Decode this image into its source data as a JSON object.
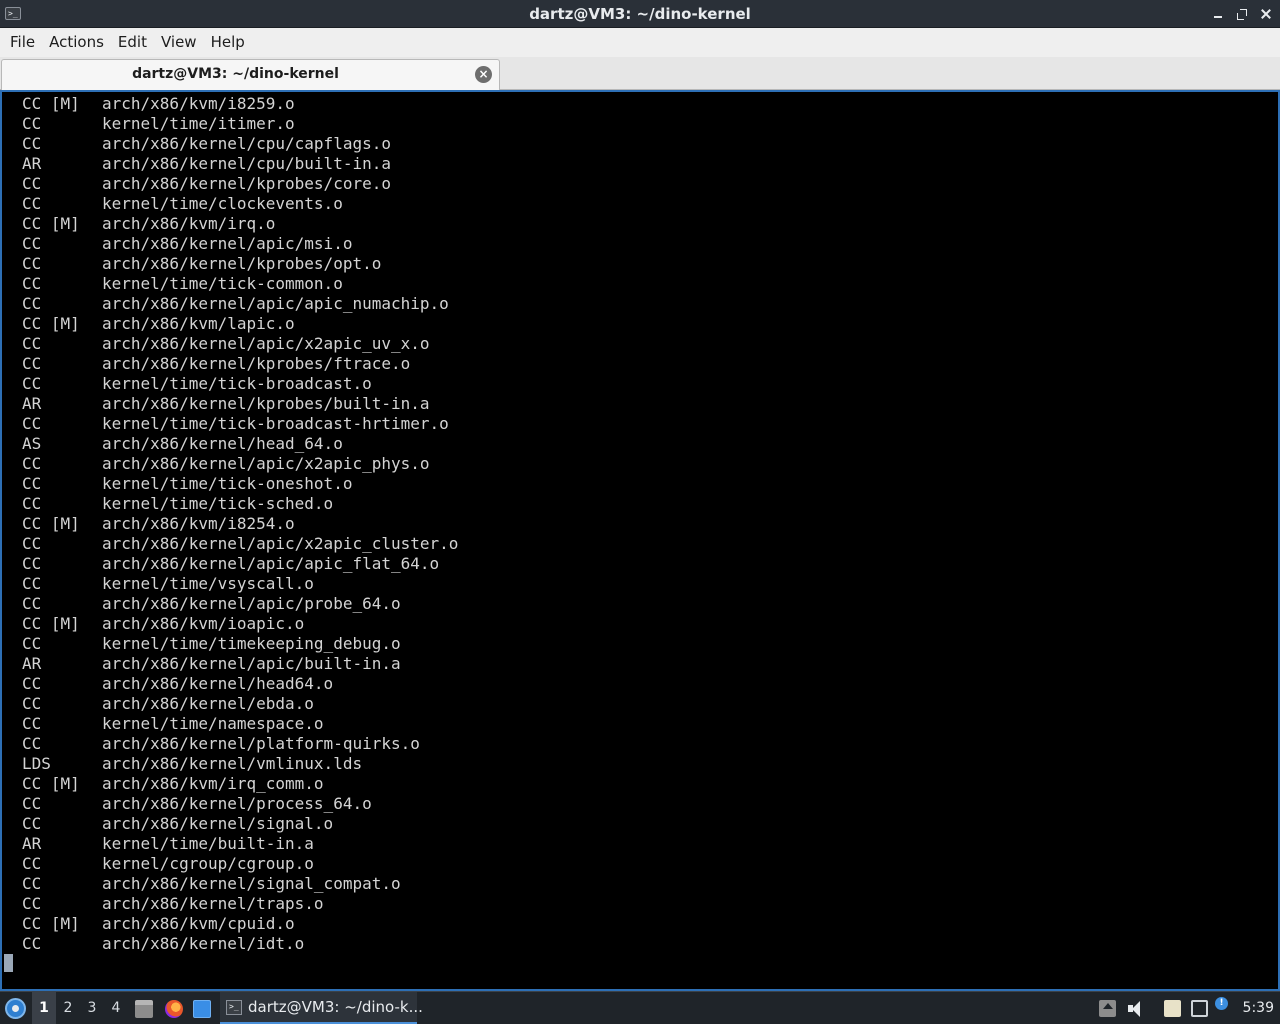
{
  "window": {
    "title": "dartz@VM3: ~/dino-kernel",
    "icon": "terminal-icon"
  },
  "menubar": {
    "items": [
      "File",
      "Actions",
      "Edit",
      "View",
      "Help"
    ]
  },
  "tabs": [
    {
      "label": "dartz@VM3: ~/dino-kernel",
      "close_icon": "close-circle-icon"
    }
  ],
  "terminal": {
    "lines": [
      {
        "tag": "CC [M]",
        "path": "arch/x86/kvm/i8259.o"
      },
      {
        "tag": "CC",
        "path": "kernel/time/itimer.o"
      },
      {
        "tag": "CC",
        "path": "arch/x86/kernel/cpu/capflags.o"
      },
      {
        "tag": "AR",
        "path": "arch/x86/kernel/cpu/built-in.a"
      },
      {
        "tag": "CC",
        "path": "arch/x86/kernel/kprobes/core.o"
      },
      {
        "tag": "CC",
        "path": "kernel/time/clockevents.o"
      },
      {
        "tag": "CC [M]",
        "path": "arch/x86/kvm/irq.o"
      },
      {
        "tag": "CC",
        "path": "arch/x86/kernel/apic/msi.o"
      },
      {
        "tag": "CC",
        "path": "arch/x86/kernel/kprobes/opt.o"
      },
      {
        "tag": "CC",
        "path": "kernel/time/tick-common.o"
      },
      {
        "tag": "CC",
        "path": "arch/x86/kernel/apic/apic_numachip.o"
      },
      {
        "tag": "CC [M]",
        "path": "arch/x86/kvm/lapic.o"
      },
      {
        "tag": "CC",
        "path": "arch/x86/kernel/apic/x2apic_uv_x.o"
      },
      {
        "tag": "CC",
        "path": "arch/x86/kernel/kprobes/ftrace.o"
      },
      {
        "tag": "CC",
        "path": "kernel/time/tick-broadcast.o"
      },
      {
        "tag": "AR",
        "path": "arch/x86/kernel/kprobes/built-in.a"
      },
      {
        "tag": "CC",
        "path": "kernel/time/tick-broadcast-hrtimer.o"
      },
      {
        "tag": "AS",
        "path": "arch/x86/kernel/head_64.o"
      },
      {
        "tag": "CC",
        "path": "arch/x86/kernel/apic/x2apic_phys.o"
      },
      {
        "tag": "CC",
        "path": "kernel/time/tick-oneshot.o"
      },
      {
        "tag": "CC",
        "path": "kernel/time/tick-sched.o"
      },
      {
        "tag": "CC [M]",
        "path": "arch/x86/kvm/i8254.o"
      },
      {
        "tag": "CC",
        "path": "arch/x86/kernel/apic/x2apic_cluster.o"
      },
      {
        "tag": "CC",
        "path": "arch/x86/kernel/apic/apic_flat_64.o"
      },
      {
        "tag": "CC",
        "path": "kernel/time/vsyscall.o"
      },
      {
        "tag": "CC",
        "path": "arch/x86/kernel/apic/probe_64.o"
      },
      {
        "tag": "CC [M]",
        "path": "arch/x86/kvm/ioapic.o"
      },
      {
        "tag": "CC",
        "path": "kernel/time/timekeeping_debug.o"
      },
      {
        "tag": "AR",
        "path": "arch/x86/kernel/apic/built-in.a"
      },
      {
        "tag": "CC",
        "path": "arch/x86/kernel/head64.o"
      },
      {
        "tag": "CC",
        "path": "arch/x86/kernel/ebda.o"
      },
      {
        "tag": "CC",
        "path": "kernel/time/namespace.o"
      },
      {
        "tag": "CC",
        "path": "arch/x86/kernel/platform-quirks.o"
      },
      {
        "tag": "LDS",
        "path": "arch/x86/kernel/vmlinux.lds"
      },
      {
        "tag": "CC [M]",
        "path": "arch/x86/kvm/irq_comm.o"
      },
      {
        "tag": "CC",
        "path": "arch/x86/kernel/process_64.o"
      },
      {
        "tag": "CC",
        "path": "arch/x86/kernel/signal.o"
      },
      {
        "tag": "AR",
        "path": "kernel/time/built-in.a"
      },
      {
        "tag": "CC",
        "path": "kernel/cgroup/cgroup.o"
      },
      {
        "tag": "CC",
        "path": "arch/x86/kernel/signal_compat.o"
      },
      {
        "tag": "CC",
        "path": "arch/x86/kernel/traps.o"
      },
      {
        "tag": "CC [M]",
        "path": "arch/x86/kvm/cpuid.o"
      },
      {
        "tag": "CC",
        "path": "arch/x86/kernel/idt.o"
      }
    ]
  },
  "taskbar": {
    "start_icon": "start-menu-icon",
    "workspaces": [
      "1",
      "2",
      "3",
      "4"
    ],
    "active_workspace": "1",
    "launchers": [
      "file-manager-icon",
      "firefox-icon",
      "show-desktop-icon"
    ],
    "task_label": "dartz@VM3: ~/dino-k...",
    "tray_icons": [
      "removable-media-icon",
      "volume-icon",
      "clipboard-icon",
      "network-icon",
      "notification-icon"
    ],
    "notify_badge": "!",
    "clock": "5:39"
  },
  "colors": {
    "titlebar_bg": "#2a3038",
    "terminal_bg": "#000000",
    "terminal_fg": "#d4d4d4",
    "terminal_border": "#2d6fb5",
    "taskbar_bg": "#1f2429"
  }
}
